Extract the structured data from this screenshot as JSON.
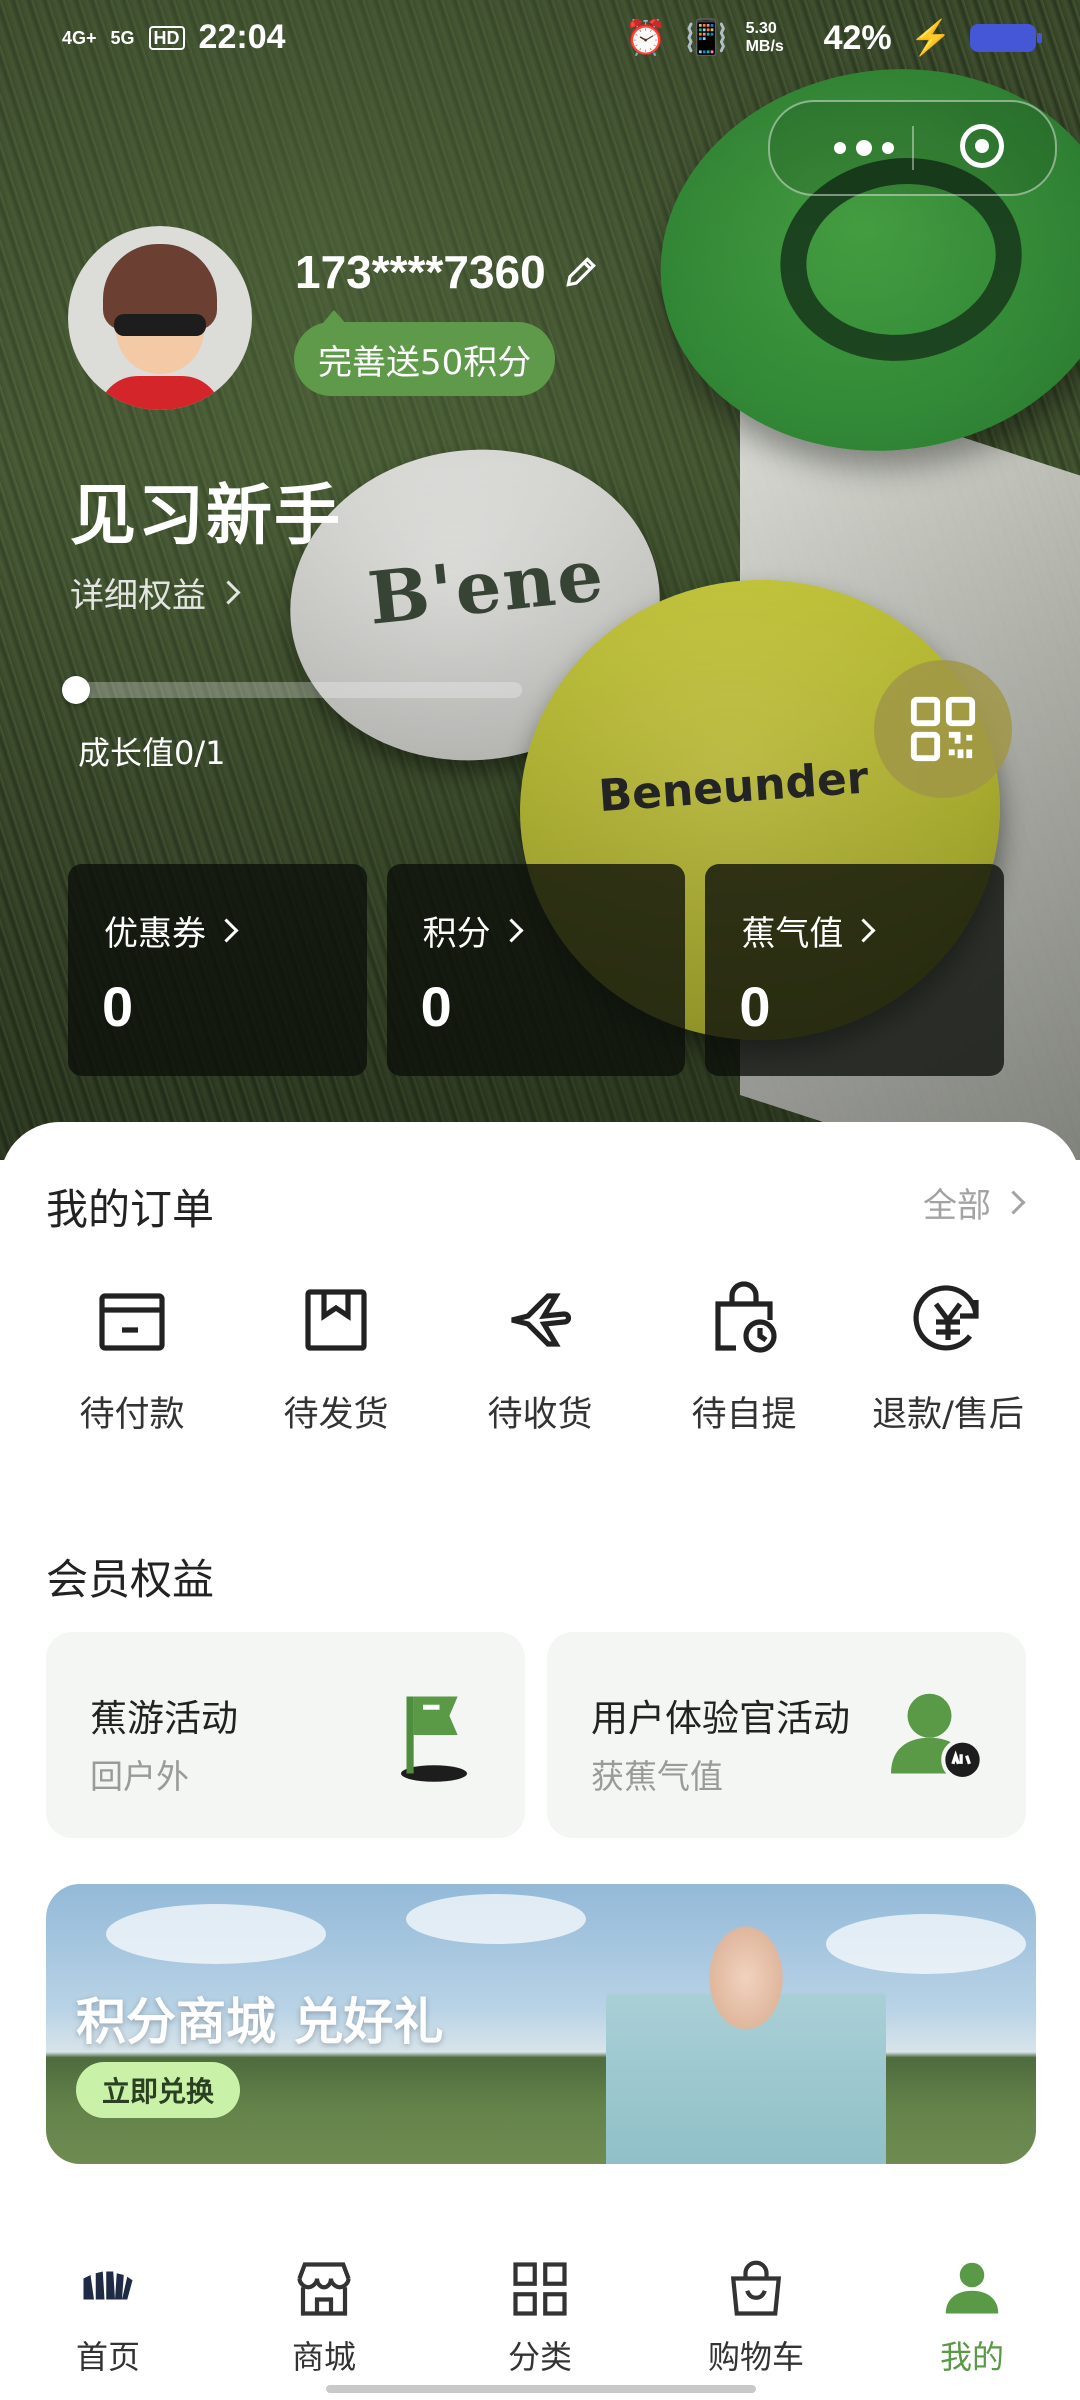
{
  "status_bar": {
    "time": "22:04",
    "signal1": "4G+",
    "signal2": "5G",
    "hd": "HD",
    "net_speed": "5.30 MB/s",
    "battery": "42%"
  },
  "profile": {
    "phone": "173****7360",
    "complete_prompt": "完善送50积分",
    "level": "见习新手",
    "rights_link": "详细权益",
    "growth_label": "成长值0/1",
    "growth_progress": 0
  },
  "stats": [
    {
      "label": "优惠券",
      "value": "0"
    },
    {
      "label": "积分",
      "value": "0"
    },
    {
      "label": "蕉气值",
      "value": "0"
    }
  ],
  "orders": {
    "title": "我的订单",
    "all_link": "全部",
    "items": [
      {
        "label": "待付款",
        "icon": "wallet-icon"
      },
      {
        "label": "待发货",
        "icon": "package-icon"
      },
      {
        "label": "待收货",
        "icon": "plane-icon"
      },
      {
        "label": "待自提",
        "icon": "bag-clock-icon"
      },
      {
        "label": "退款/售后",
        "icon": "yuan-refund-icon"
      }
    ]
  },
  "benefits": {
    "title": "会员权益",
    "items": [
      {
        "title": "蕉游活动",
        "subtitle": "回户外",
        "icon": "flag-icon"
      },
      {
        "title": "用户体验官活动",
        "subtitle": "获蕉气值",
        "icon": "user-badge-icon"
      }
    ]
  },
  "banner": {
    "headline": "积分商城 兑好礼",
    "cta": "立即兑换"
  },
  "tabbar": [
    {
      "label": "首页",
      "icon": "home-logo-icon"
    },
    {
      "label": "商城",
      "icon": "store-icon"
    },
    {
      "label": "分类",
      "icon": "category-grid-icon"
    },
    {
      "label": "购物车",
      "icon": "shopping-bag-icon"
    },
    {
      "label": "我的",
      "icon": "user-icon",
      "active": true
    }
  ],
  "colors": {
    "accent_green": "#5a9a46",
    "prompt_green": "#5f9a4b",
    "cta_green": "#c9f2a8"
  }
}
